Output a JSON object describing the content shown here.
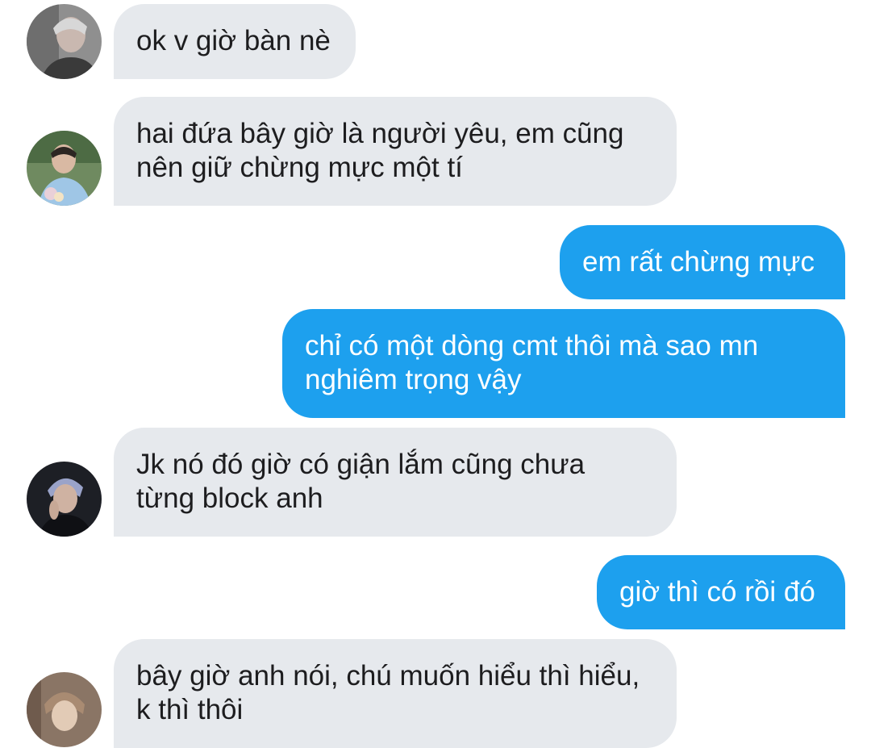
{
  "messages": [
    {
      "direction": "in",
      "avatar": "avatar-1",
      "text": "ok v giờ bàn nè"
    },
    {
      "direction": "in",
      "avatar": "avatar-2",
      "text": "hai đứa bây giờ là người yêu, em cũng\nnên giữ chừng mực một tí"
    },
    {
      "direction": "out",
      "text": "em rất chừng mực"
    },
    {
      "direction": "out",
      "text": "chỉ có một dòng cmt thôi mà sao mn\nnghiêm trọng vậy"
    },
    {
      "direction": "in",
      "avatar": "avatar-3",
      "text": "Jk nó đó giờ có giận lắm cũng chưa\ntừng block anh"
    },
    {
      "direction": "out",
      "text": "giờ thì có rồi đó"
    },
    {
      "direction": "in",
      "avatar": "avatar-4",
      "text": "bây giờ anh nói, chú muốn hiểu thì hiểu,\nk thì thôi"
    }
  ],
  "colors": {
    "incoming_bubble": "#e6e9ed",
    "outgoing_bubble": "#1da0ee",
    "incoming_text": "#1d1d1f",
    "outgoing_text": "#ffffff"
  }
}
